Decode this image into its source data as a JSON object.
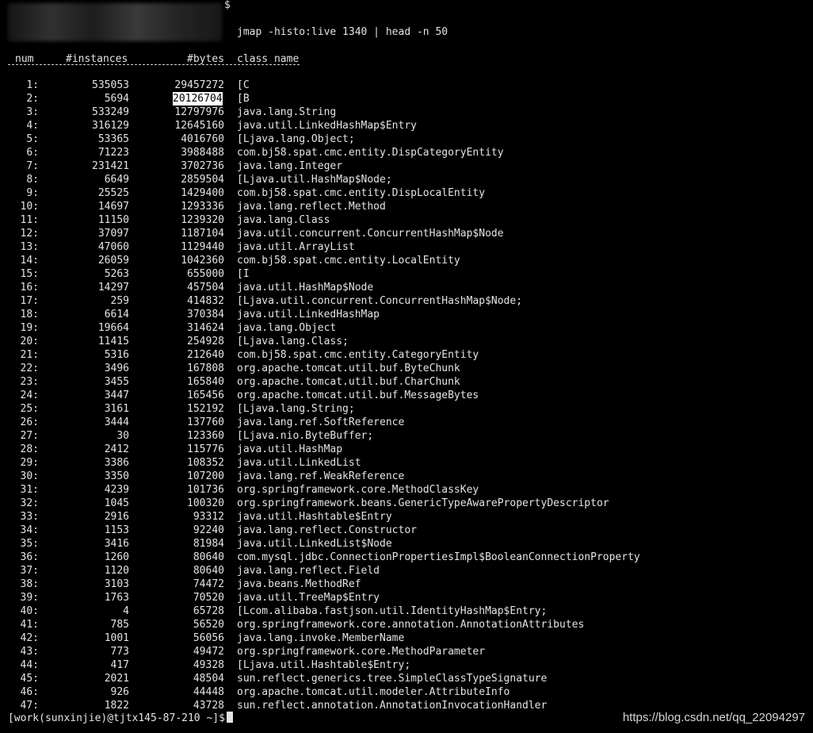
{
  "prompt_symbol": "$",
  "command": "jmap -histo:live 1340 | head -n 50",
  "headers": {
    "num": "num",
    "instances": "#instances",
    "bytes": "#bytes",
    "class_name": "class name"
  },
  "rows": [
    {
      "num": "1:",
      "instances": "535053",
      "bytes": "29457272",
      "class": "[C"
    },
    {
      "num": "2:",
      "instances": "5694",
      "bytes": "20126704",
      "class": "[B",
      "highlight": true
    },
    {
      "num": "3:",
      "instances": "533249",
      "bytes": "12797976",
      "class": "java.lang.String"
    },
    {
      "num": "4:",
      "instances": "316129",
      "bytes": "12645160",
      "class": "java.util.LinkedHashMap$Entry"
    },
    {
      "num": "5:",
      "instances": "53365",
      "bytes": "4016760",
      "class": "[Ljava.lang.Object;"
    },
    {
      "num": "6:",
      "instances": "71223",
      "bytes": "3988488",
      "class": "com.bj58.spat.cmc.entity.DispCategoryEntity"
    },
    {
      "num": "7:",
      "instances": "231421",
      "bytes": "3702736",
      "class": "java.lang.Integer"
    },
    {
      "num": "8:",
      "instances": "6649",
      "bytes": "2859504",
      "class": "[Ljava.util.HashMap$Node;"
    },
    {
      "num": "9:",
      "instances": "25525",
      "bytes": "1429400",
      "class": "com.bj58.spat.cmc.entity.DispLocalEntity"
    },
    {
      "num": "10:",
      "instances": "14697",
      "bytes": "1293336",
      "class": "java.lang.reflect.Method"
    },
    {
      "num": "11:",
      "instances": "11150",
      "bytes": "1239320",
      "class": "java.lang.Class"
    },
    {
      "num": "12:",
      "instances": "37097",
      "bytes": "1187104",
      "class": "java.util.concurrent.ConcurrentHashMap$Node"
    },
    {
      "num": "13:",
      "instances": "47060",
      "bytes": "1129440",
      "class": "java.util.ArrayList"
    },
    {
      "num": "14:",
      "instances": "26059",
      "bytes": "1042360",
      "class": "com.bj58.spat.cmc.entity.LocalEntity"
    },
    {
      "num": "15:",
      "instances": "5263",
      "bytes": "655000",
      "class": "[I"
    },
    {
      "num": "16:",
      "instances": "14297",
      "bytes": "457504",
      "class": "java.util.HashMap$Node"
    },
    {
      "num": "17:",
      "instances": "259",
      "bytes": "414832",
      "class": "[Ljava.util.concurrent.ConcurrentHashMap$Node;"
    },
    {
      "num": "18:",
      "instances": "6614",
      "bytes": "370384",
      "class": "java.util.LinkedHashMap"
    },
    {
      "num": "19:",
      "instances": "19664",
      "bytes": "314624",
      "class": "java.lang.Object"
    },
    {
      "num": "20:",
      "instances": "11415",
      "bytes": "254928",
      "class": "[Ljava.lang.Class;"
    },
    {
      "num": "21:",
      "instances": "5316",
      "bytes": "212640",
      "class": "com.bj58.spat.cmc.entity.CategoryEntity"
    },
    {
      "num": "22:",
      "instances": "3496",
      "bytes": "167808",
      "class": "org.apache.tomcat.util.buf.ByteChunk"
    },
    {
      "num": "23:",
      "instances": "3455",
      "bytes": "165840",
      "class": "org.apache.tomcat.util.buf.CharChunk"
    },
    {
      "num": "24:",
      "instances": "3447",
      "bytes": "165456",
      "class": "org.apache.tomcat.util.buf.MessageBytes"
    },
    {
      "num": "25:",
      "instances": "3161",
      "bytes": "152192",
      "class": "[Ljava.lang.String;"
    },
    {
      "num": "26:",
      "instances": "3444",
      "bytes": "137760",
      "class": "java.lang.ref.SoftReference"
    },
    {
      "num": "27:",
      "instances": "30",
      "bytes": "123360",
      "class": "[Ljava.nio.ByteBuffer;"
    },
    {
      "num": "28:",
      "instances": "2412",
      "bytes": "115776",
      "class": "java.util.HashMap"
    },
    {
      "num": "29:",
      "instances": "3386",
      "bytes": "108352",
      "class": "java.util.LinkedList"
    },
    {
      "num": "30:",
      "instances": "3350",
      "bytes": "107200",
      "class": "java.lang.ref.WeakReference"
    },
    {
      "num": "31:",
      "instances": "4239",
      "bytes": "101736",
      "class": "org.springframework.core.MethodClassKey"
    },
    {
      "num": "32:",
      "instances": "1045",
      "bytes": "100320",
      "class": "org.springframework.beans.GenericTypeAwarePropertyDescriptor"
    },
    {
      "num": "33:",
      "instances": "2916",
      "bytes": "93312",
      "class": "java.util.Hashtable$Entry"
    },
    {
      "num": "34:",
      "instances": "1153",
      "bytes": "92240",
      "class": "java.lang.reflect.Constructor"
    },
    {
      "num": "35:",
      "instances": "3416",
      "bytes": "81984",
      "class": "java.util.LinkedList$Node"
    },
    {
      "num": "36:",
      "instances": "1260",
      "bytes": "80640",
      "class": "com.mysql.jdbc.ConnectionPropertiesImpl$BooleanConnectionProperty"
    },
    {
      "num": "37:",
      "instances": "1120",
      "bytes": "80640",
      "class": "java.lang.reflect.Field"
    },
    {
      "num": "38:",
      "instances": "3103",
      "bytes": "74472",
      "class": "java.beans.MethodRef"
    },
    {
      "num": "39:",
      "instances": "1763",
      "bytes": "70520",
      "class": "java.util.TreeMap$Entry"
    },
    {
      "num": "40:",
      "instances": "4",
      "bytes": "65728",
      "class": "[Lcom.alibaba.fastjson.util.IdentityHashMap$Entry;"
    },
    {
      "num": "41:",
      "instances": "785",
      "bytes": "56520",
      "class": "org.springframework.core.annotation.AnnotationAttributes"
    },
    {
      "num": "42:",
      "instances": "1001",
      "bytes": "56056",
      "class": "java.lang.invoke.MemberName"
    },
    {
      "num": "43:",
      "instances": "773",
      "bytes": "49472",
      "class": "org.springframework.core.MethodParameter"
    },
    {
      "num": "44:",
      "instances": "417",
      "bytes": "49328",
      "class": "[Ljava.util.Hashtable$Entry;"
    },
    {
      "num": "45:",
      "instances": "2021",
      "bytes": "48504",
      "class": "sun.reflect.generics.tree.SimpleClassTypeSignature"
    },
    {
      "num": "46:",
      "instances": "926",
      "bytes": "44448",
      "class": "org.apache.tomcat.util.modeler.AttributeInfo"
    },
    {
      "num": "47:",
      "instances": "1822",
      "bytes": "43728",
      "class": "sun.reflect.annotation.AnnotationInvocationHandler"
    }
  ],
  "final_prompt": "[work(sunxinjie)@tjtx145-87-210 ~]$",
  "watermark": "https://blog.csdn.net/qq_22094297"
}
